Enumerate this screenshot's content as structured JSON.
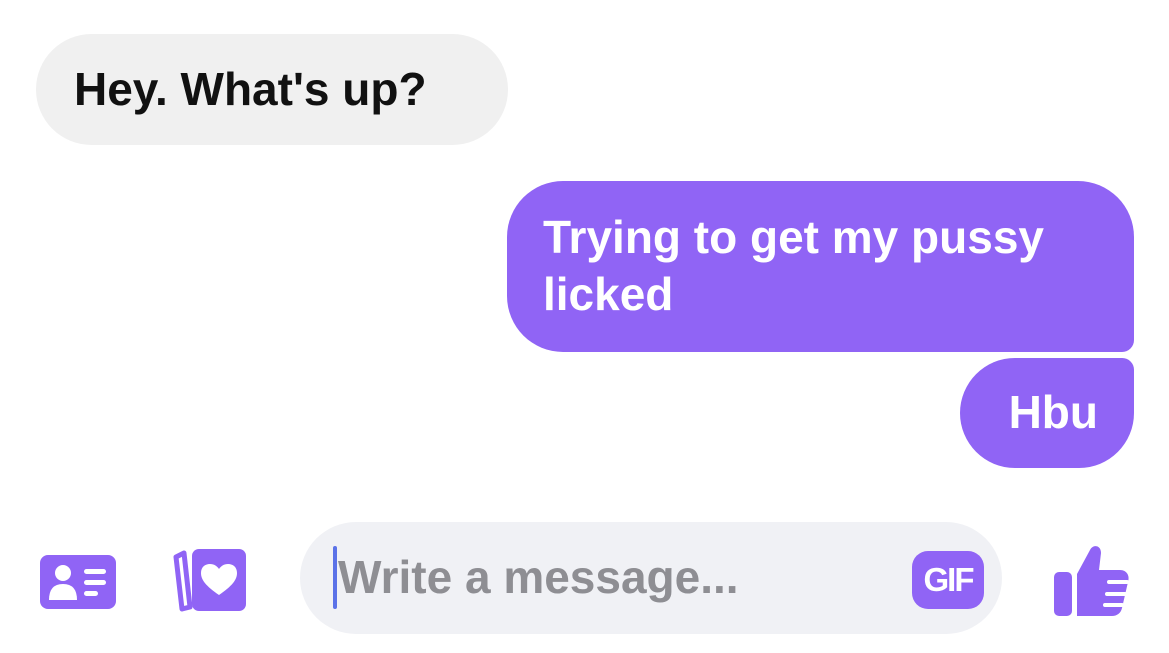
{
  "accent_color": "#9064f5",
  "messages": [
    {
      "direction": "incoming",
      "text": "Hey. What's up?"
    },
    {
      "direction": "outgoing",
      "text": "Trying to get my pussy licked"
    },
    {
      "direction": "outgoing",
      "text": "Hbu"
    }
  ],
  "composer": {
    "placeholder": "Write a message...",
    "value": "",
    "gif_label": "GIF",
    "icons": {
      "left_1": "contact-card-icon",
      "left_2": "cards-heart-icon",
      "right": "thumbs-up-icon"
    }
  }
}
